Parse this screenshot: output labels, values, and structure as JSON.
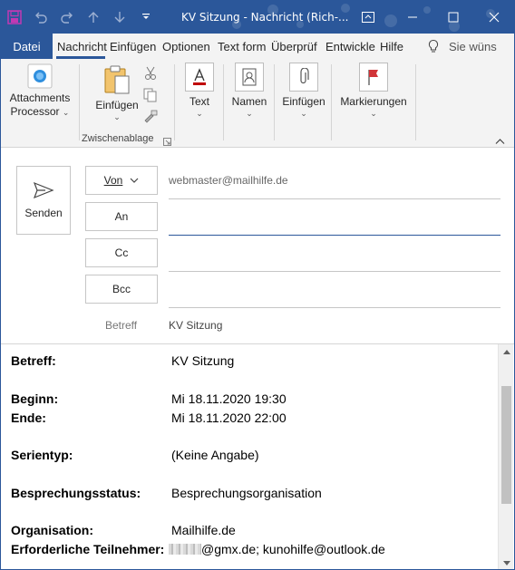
{
  "window": {
    "title": "KV Sitzung  -  Nachricht (Rich-..."
  },
  "tabs": [
    {
      "label": "Datei"
    },
    {
      "label": "Nachricht"
    },
    {
      "label": "Einfügen"
    },
    {
      "label": "Optionen"
    },
    {
      "label": "Text form"
    },
    {
      "label": "Überprüf"
    },
    {
      "label": "Entwickle"
    },
    {
      "label": "Hilfe"
    }
  ],
  "tell_me": {
    "label": "Sie wüns"
  },
  "ribbon": {
    "attachments_processor": "Attachments",
    "attachments_processor_line2": "Processor",
    "einfuegen_label": "Einfügen",
    "zwischenablage_label": "Zwischenablage",
    "text_label": "Text",
    "namen_label": "Namen",
    "einfuegen2_label": "Einfügen",
    "markierungen_label": "Markierungen"
  },
  "compose": {
    "send_label": "Senden",
    "from_label": "Von",
    "from_value": "webmaster@mailhilfe.de",
    "to_label": "An",
    "cc_label": "Cc",
    "bcc_label": "Bcc",
    "subject_label": "Betreff",
    "subject_value": "KV Sitzung"
  },
  "body": {
    "rows": [
      {
        "k": "Betreff:",
        "v": "KV Sitzung"
      },
      {
        "k": "Beginn:",
        "v": "Mi 18.11.2020 19:30"
      },
      {
        "k": "Ende:",
        "v": "Mi 18.11.2020 22:00"
      },
      {
        "k": "Serientyp:",
        "v": "(Keine Angabe)"
      },
      {
        "k": "Besprechungsstatus:",
        "v": "Besprechungsorganisation"
      },
      {
        "k": "Organisation:",
        "v": "Mailhilfe.de"
      },
      {
        "k": "Erforderliche Teilnehmer:",
        "v": "@gmx.de; kunohilfe@outlook.de"
      }
    ]
  },
  "colors": {
    "accent": "#2b579a",
    "ribbon_bg": "#f3f3f3",
    "flag_red": "#d13438"
  },
  "icons": [
    "save-icon",
    "undo-icon",
    "redo-icon",
    "up-arrow-icon",
    "down-arrow-icon",
    "customize-qat-icon",
    "restore-window-icon",
    "minimize-icon",
    "maximize-icon",
    "close-icon",
    "attachments-processor-icon",
    "paste-icon",
    "cut-icon",
    "copy-icon",
    "format-painter-icon",
    "text-icon",
    "address-book-icon",
    "paperclip-icon",
    "flag-icon",
    "send-icon",
    "lightbulb-icon"
  ]
}
